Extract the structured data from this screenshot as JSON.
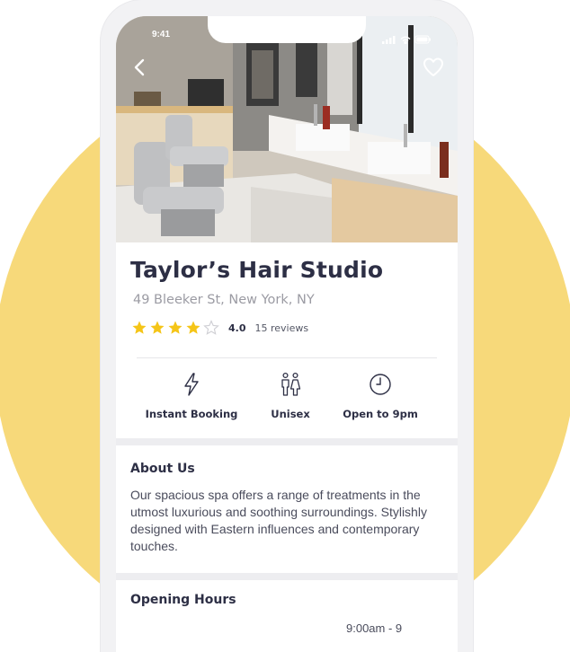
{
  "status_bar": {
    "time": "9:41"
  },
  "business": {
    "name": "Taylor’s Hair Studio",
    "address": "49 Bleeker St, New York, NY",
    "rating": 4.0,
    "rating_label": "4.0",
    "reviews_label": "15 reviews"
  },
  "features": [
    {
      "label": "Instant Booking",
      "icon": "lightning-icon"
    },
    {
      "label": "Unisex",
      "icon": "male-female-icon"
    },
    {
      "label": "Open to 9pm",
      "icon": "clock-icon"
    }
  ],
  "about": {
    "title": "About Us",
    "text": "Our spacious spa offers a range of treatments in the utmost luxurious and soothing surroundings. Stylishly designed with Eastern influences and contemporary touches."
  },
  "hours": {
    "title": "Opening Hours",
    "first_row_time": "9:00am - 9"
  },
  "colors": {
    "accent_background": "#f7d97a",
    "star": "#f5c518",
    "title_text": "#2d2f45"
  }
}
